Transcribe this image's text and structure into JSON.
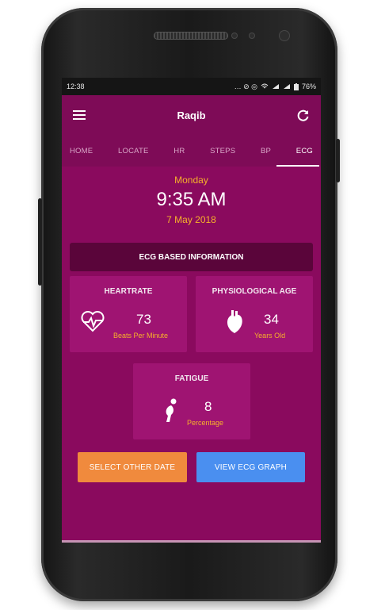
{
  "status": {
    "time": "12:38",
    "battery": "76%"
  },
  "header": {
    "title": "Raqib"
  },
  "tabs": [
    {
      "label": "HOME"
    },
    {
      "label": "LOCATE"
    },
    {
      "label": "HR"
    },
    {
      "label": "STEPS"
    },
    {
      "label": "BP"
    },
    {
      "label": "ECG"
    }
  ],
  "datetime": {
    "day": "Monday",
    "time": "9:35 AM",
    "date": "7 May 2018"
  },
  "section": {
    "title": "ECG BASED INFORMATION"
  },
  "cards": {
    "heartrate": {
      "label": "HEARTRATE",
      "value": "73",
      "unit": "Beats Per Minute"
    },
    "physio": {
      "label": "PHYSIOLOGICAL AGE",
      "value": "34",
      "unit": "Years Old"
    },
    "fatigue": {
      "label": "FATIGUE",
      "value": "8",
      "unit": "Percentage"
    }
  },
  "buttons": {
    "select_date": "SELECT OTHER DATE",
    "view_graph": "VIEW ECG GRAPH"
  },
  "colors": {
    "background": "#8a0a5e",
    "accent": "#f7b12a",
    "orange": "#f08a3d",
    "blue": "#4a8ff0"
  }
}
